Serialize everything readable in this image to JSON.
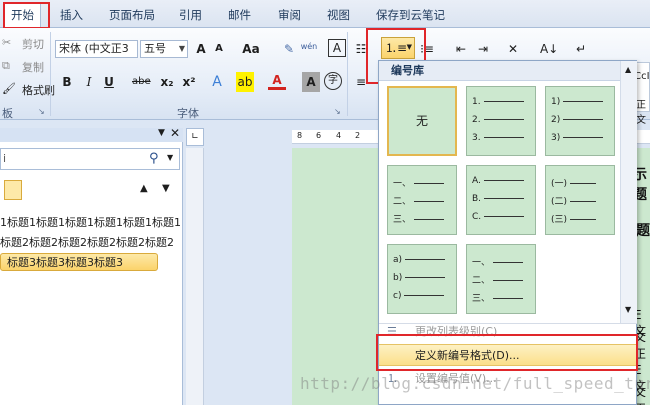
{
  "tabs": [
    "开始",
    "插入",
    "页面布局",
    "引用",
    "邮件",
    "审阅",
    "视图",
    "保存到云笔记"
  ],
  "clipboard": {
    "cut": "剪切",
    "copy": "复制",
    "format_painter": "格式刷",
    "group_label": "板"
  },
  "font": {
    "name": "宋体 (中文正3",
    "size": "五号",
    "grow": "A",
    "shrink": "A",
    "change_case": "Aa",
    "pinyin": "wén",
    "char_border": "A",
    "bold": "B",
    "italic": "I",
    "underline": "U",
    "strike": "abe",
    "subscript": "x₂",
    "superscript": "x²",
    "text_effect": "A",
    "highlight": "ab",
    "font_color": "A",
    "char_shading": "A",
    "enclose": "字",
    "group_label": "字体"
  },
  "styles": {
    "sample": "AaBbCcI",
    "sample2": "正文"
  },
  "nav": {
    "search_placeholder": "i",
    "items": [
      "1标题1标题1标题1标题1标题1标题1",
      "标题2标题2标题2标题2标题2标题2",
      "标题3标题3标题3标题3"
    ]
  },
  "ruler": [
    "8",
    "6",
    "4",
    "2"
  ],
  "document_fragments": [
    "示题",
    "题",
    "E文",
    "文正",
    "E文",
    "文正"
  ],
  "dropdown": {
    "title": "编号库",
    "none_label": "无",
    "cells": [
      {
        "markers": [
          "1.",
          "2.",
          "3."
        ]
      },
      {
        "markers": [
          "1)",
          "2)",
          "3)"
        ]
      },
      {
        "markers": [
          "一、",
          "二、",
          "三、"
        ]
      },
      {
        "markers": [
          "A.",
          "B.",
          "C."
        ]
      },
      {
        "markers": [
          "(一)",
          "(二)",
          "(三)"
        ]
      },
      {
        "markers": [
          "a)",
          "b)",
          "c)"
        ]
      },
      {
        "markers": [
          "一、",
          "二、",
          "三、"
        ]
      }
    ],
    "menu": {
      "change_level": "更改列表级别(C)",
      "define_new": "定义新编号格式(D)...",
      "set_value": "设置编号值(V)..."
    }
  },
  "watermark": "http://blog.csdn.net/full_speed_turbo",
  "colors": {
    "accent_red": "#e0262a",
    "highlight_yellow": "#fbd36b",
    "doc_green": "#cce8cf"
  }
}
